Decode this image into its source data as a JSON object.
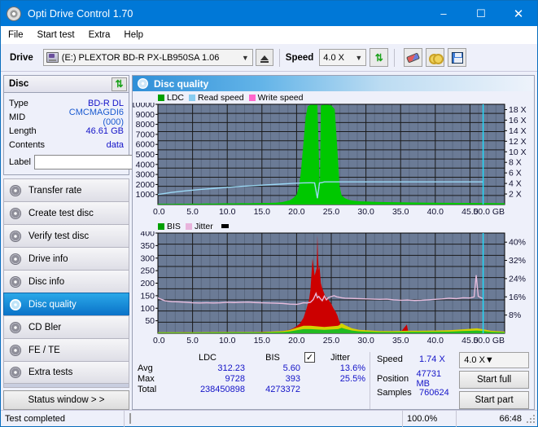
{
  "window": {
    "title": "Opti Drive Control 1.70",
    "icon": "disc-icon",
    "minimize": "–",
    "maximize": "☐",
    "close": "✕"
  },
  "menubar": {
    "items": [
      "File",
      "Start test",
      "Extra",
      "Help"
    ]
  },
  "toolbar": {
    "drive_label": "Drive",
    "drive_value": "(E:)   PLEXTOR BD-R  PX-LB950SA 1.06",
    "eject_title": "eject-button",
    "speed_label": "Speed",
    "speed_value": "4.0 X",
    "buttons": [
      "refresh-icon",
      "eraser-icon",
      "gold-disc-icon",
      "save-icon"
    ]
  },
  "disc": {
    "header": "Disc",
    "refresh_icon": "refresh-icon",
    "rows": [
      {
        "key": "Type",
        "value": "BD-R DL"
      },
      {
        "key": "MID",
        "value": "CMCMAGDI6 (000)"
      },
      {
        "key": "Length",
        "value": "46.61 GB"
      },
      {
        "key": "Contents",
        "value": "data"
      }
    ],
    "label_key": "Label",
    "label_value": "",
    "label_placeholder": ""
  },
  "nav": {
    "items": [
      {
        "label": "Transfer rate",
        "selected": false
      },
      {
        "label": "Create test disc",
        "selected": false
      },
      {
        "label": "Verify test disc",
        "selected": false
      },
      {
        "label": "Drive info",
        "selected": false
      },
      {
        "label": "Disc info",
        "selected": false
      },
      {
        "label": "Disc quality",
        "selected": true
      },
      {
        "label": "CD Bler",
        "selected": false
      },
      {
        "label": "FE / TE",
        "selected": false
      },
      {
        "label": "Extra tests",
        "selected": false
      }
    ],
    "status_window": "Status window > >"
  },
  "panel": {
    "title": "Disc quality",
    "icon": "disc-quality-icon"
  },
  "chart_data": [
    {
      "type": "area",
      "id": "ldc-chart",
      "title": "",
      "legend": [
        {
          "label": "LDC",
          "color": "#00c000"
        },
        {
          "label": "Read speed",
          "color": "#88ccf0"
        },
        {
          "label": "Write speed",
          "color": "#ff66cc"
        }
      ],
      "legend_position": "top-left",
      "grid": true,
      "xlabel": "GB",
      "x_ticks": [
        "0.0",
        "5.0",
        "10.0",
        "15.0",
        "20.0",
        "25.0",
        "30.0",
        "35.0",
        "40.0",
        "45.0",
        "50.0 GB"
      ],
      "xlim": [
        0,
        50
      ],
      "ylabel_left": "LDC",
      "y_ticks_left": [
        "10000",
        "9000",
        "8000",
        "7000",
        "6000",
        "5000",
        "4000",
        "3000",
        "2000",
        "1000"
      ],
      "ylim_left": [
        0,
        10000
      ],
      "ylabel_right": "Speed",
      "y_ticks_right": [
        "18 X",
        "16 X",
        "14 X",
        "12 X",
        "10 X",
        "8 X",
        "6 X",
        "4 X",
        "2 X"
      ],
      "ylim_right": [
        0,
        19
      ],
      "series": [
        {
          "name": "LDC",
          "color": "#00c000",
          "x": [
            0,
            1,
            2,
            3,
            4,
            5,
            6,
            7,
            8,
            9,
            10,
            11,
            12,
            13,
            14,
            15,
            16,
            17,
            18,
            19,
            19.5,
            20,
            20.3,
            20.6,
            21,
            21.3,
            21.6,
            22,
            22.5,
            23,
            23.2,
            23.35,
            23.5,
            24,
            24.5,
            25,
            25.5,
            26,
            26.2,
            26.5,
            27,
            27.5,
            28,
            29,
            30,
            31,
            32,
            33,
            34,
            35,
            36,
            37,
            38,
            39,
            40,
            41,
            42,
            43,
            44,
            45,
            46,
            47,
            48,
            49,
            50
          ],
          "values": [
            60,
            70,
            65,
            80,
            75,
            90,
            85,
            100,
            95,
            110,
            120,
            115,
            130,
            125,
            140,
            150,
            160,
            185,
            250,
            420,
            640,
            980,
            1700,
            3100,
            6200,
            8700,
            9800,
            9950,
            9950,
            9950,
            5200,
            1200,
            9900,
            9950,
            9950,
            9900,
            9500,
            4200,
            1800,
            900,
            620,
            480,
            400,
            330,
            300,
            270,
            250,
            240,
            230,
            220,
            210,
            200,
            190,
            185,
            180,
            175,
            170,
            165,
            160,
            155,
            150,
            145,
            140,
            135,
            130
          ]
        },
        {
          "name": "Read speed",
          "color": "#88ccf0",
          "x": [
            0,
            2,
            4,
            6,
            8,
            10,
            12,
            14,
            16,
            18,
            20,
            21,
            22,
            22.6,
            23,
            23.3,
            23.6,
            24,
            26,
            28,
            30,
            32,
            34,
            36,
            38,
            40,
            42,
            44,
            46,
            46.9
          ],
          "values": [
            1.9,
            2.3,
            2.6,
            2.85,
            3.05,
            3.25,
            3.45,
            3.6,
            3.75,
            3.9,
            4.05,
            4.1,
            4.12,
            4.1,
            1.2,
            4.1,
            4.15,
            4.3,
            4.3,
            4.3,
            4.3,
            4.3,
            4.3,
            4.3,
            4.3,
            4.3,
            4.3,
            4.3,
            4.3,
            4.3
          ]
        },
        {
          "name": "Write speed",
          "color": "#ff66cc",
          "x": [],
          "values": []
        }
      ],
      "marker_line": {
        "x": 46.9,
        "color": "#22d8f8"
      }
    },
    {
      "type": "area",
      "id": "bis-jitter-chart",
      "title": "",
      "legend": [
        {
          "label": "BIS",
          "color": "#00c000"
        },
        {
          "label": "Jitter",
          "color": "#e8b4dc"
        }
      ],
      "legend_position": "top-left",
      "grid": true,
      "xlabel": "GB",
      "x_ticks": [
        "0.0",
        "5.0",
        "10.0",
        "15.0",
        "20.0",
        "25.0",
        "30.0",
        "35.0",
        "40.0",
        "45.0",
        "50.0 GB"
      ],
      "xlim": [
        0,
        50
      ],
      "ylabel_left": "BIS",
      "y_ticks_left": [
        "400",
        "350",
        "300",
        "250",
        "200",
        "150",
        "100",
        "50"
      ],
      "ylim_left": [
        0,
        400
      ],
      "ylabel_right": "Jitter",
      "y_ticks_right": [
        "40%",
        "32%",
        "24%",
        "16%",
        "8%"
      ],
      "ylim_right": [
        0,
        44
      ],
      "series": [
        {
          "name": "BIS",
          "color": "#cc0000",
          "x": [
            0,
            2,
            4,
            6,
            8,
            10,
            12,
            14,
            16,
            17,
            18,
            19,
            19.5,
            20,
            20.5,
            21,
            21.4,
            21.8,
            22,
            22.3,
            22.6,
            22.9,
            23.0,
            23.1,
            23.2,
            23.3,
            23.5,
            23.7,
            23.9,
            24.1,
            24.4,
            24.7,
            25,
            25.3,
            25.6,
            25.9,
            26.1,
            26.4,
            26.6,
            26.9,
            27.2,
            27.6,
            28,
            28.5,
            29,
            30,
            31,
            32,
            33,
            34,
            35,
            35.9,
            36.1,
            37,
            38,
            39,
            40,
            41,
            42,
            43,
            44,
            45,
            45.5,
            46,
            46.5,
            47,
            48,
            49,
            50
          ],
          "values": [
            3,
            3,
            4,
            3,
            4,
            5,
            4,
            5,
            6,
            7,
            9,
            14,
            20,
            28,
            40,
            62,
            95,
            135,
            175,
            300,
            230,
            260,
            393,
            300,
            250,
            270,
            200,
            180,
            165,
            150,
            140,
            130,
            118,
            100,
            88,
            70,
            52,
            30,
            18,
            12,
            9,
            7,
            6,
            5,
            5,
            5,
            4,
            4,
            4,
            5,
            5,
            35,
            6,
            5,
            5,
            6,
            6,
            7,
            8,
            9,
            10,
            12,
            14,
            16,
            14,
            10,
            8,
            7,
            6
          ]
        },
        {
          "name": "Jitter",
          "color": "#e8b4dc",
          "x": [
            0,
            1,
            2,
            3,
            4,
            5,
            6,
            7,
            8,
            9,
            10,
            11,
            12,
            13,
            14,
            15,
            16,
            17,
            18,
            19,
            20,
            20.5,
            21,
            21.5,
            22,
            22.4,
            22.8,
            23,
            23.2,
            23.4,
            23.7,
            24,
            24.3,
            24.6,
            25,
            25.4,
            25.8,
            26,
            26.5,
            27,
            28,
            29,
            30,
            31,
            32,
            33,
            34,
            35,
            36,
            37,
            38,
            39,
            40,
            41,
            42,
            43,
            44,
            45,
            45.6,
            45.9,
            46.2,
            46.6,
            46.9
          ],
          "values": [
            15.5,
            14.3,
            13.9,
            13.8,
            13.6,
            13.4,
            13.3,
            13.4,
            13.3,
            13.4,
            13.6,
            13.5,
            13.6,
            13.7,
            13.5,
            13.4,
            13.3,
            13.2,
            13.1,
            12.8,
            12.7,
            13.0,
            13.4,
            13.3,
            13.6,
            14.8,
            17.5,
            15.6,
            16.2,
            15.3,
            14.3,
            16.3,
            14.7,
            15.7,
            16.1,
            16.5,
            16.0,
            15.9,
            15.6,
            15.4,
            15.3,
            15.2,
            15.1,
            15.0,
            14.9,
            15.0,
            14.7,
            14.5,
            14.6,
            14.4,
            14.5,
            14.7,
            14.9,
            15.1,
            15.4,
            15.2,
            15.6,
            15.5,
            16.0,
            25.5,
            16.2,
            15.6,
            15.2
          ]
        },
        {
          "name": "BIS-low",
          "color": "#d8e000",
          "x": [
            0,
            5,
            10,
            15,
            18,
            19,
            20,
            21,
            22,
            24,
            26,
            26.5,
            27,
            27.5,
            28,
            29,
            30,
            32,
            34,
            36,
            38,
            40,
            42,
            44,
            45,
            46,
            47,
            48,
            50
          ],
          "values": [
            4,
            4,
            5,
            5,
            9,
            13,
            22,
            30,
            30,
            25,
            30,
            40,
            32,
            26,
            20,
            14,
            12,
            9,
            9,
            10,
            10,
            11,
            12,
            16,
            18,
            20,
            16,
            10,
            7
          ]
        }
      ],
      "marker_line": {
        "x": 46.9,
        "color": "#22d8f8"
      }
    }
  ],
  "stats": {
    "col_headers": [
      "LDC",
      "BIS"
    ],
    "jitter_header": "Jitter",
    "jitter_checked": true,
    "rows": [
      {
        "key": "Avg",
        "ldc": "312.23",
        "bis": "5.60",
        "jitter": "13.6%"
      },
      {
        "key": "Max",
        "ldc": "9728",
        "bis": "393",
        "jitter": "25.5%"
      },
      {
        "key": "Total",
        "ldc": "238450898",
        "bis": "4273372",
        "jitter": ""
      }
    ],
    "speed_key": "Speed",
    "speed_value": "1.74 X",
    "position_key": "Position",
    "position_value": "47731 MB",
    "samples_key": "Samples",
    "samples_value": "760624",
    "speed_select": "4.0 X",
    "start_full": "Start full",
    "start_part": "Start part"
  },
  "statusbar": {
    "text": "Test completed",
    "progress_percent": 100,
    "progress_label": "100.0%",
    "time": "66:48"
  }
}
